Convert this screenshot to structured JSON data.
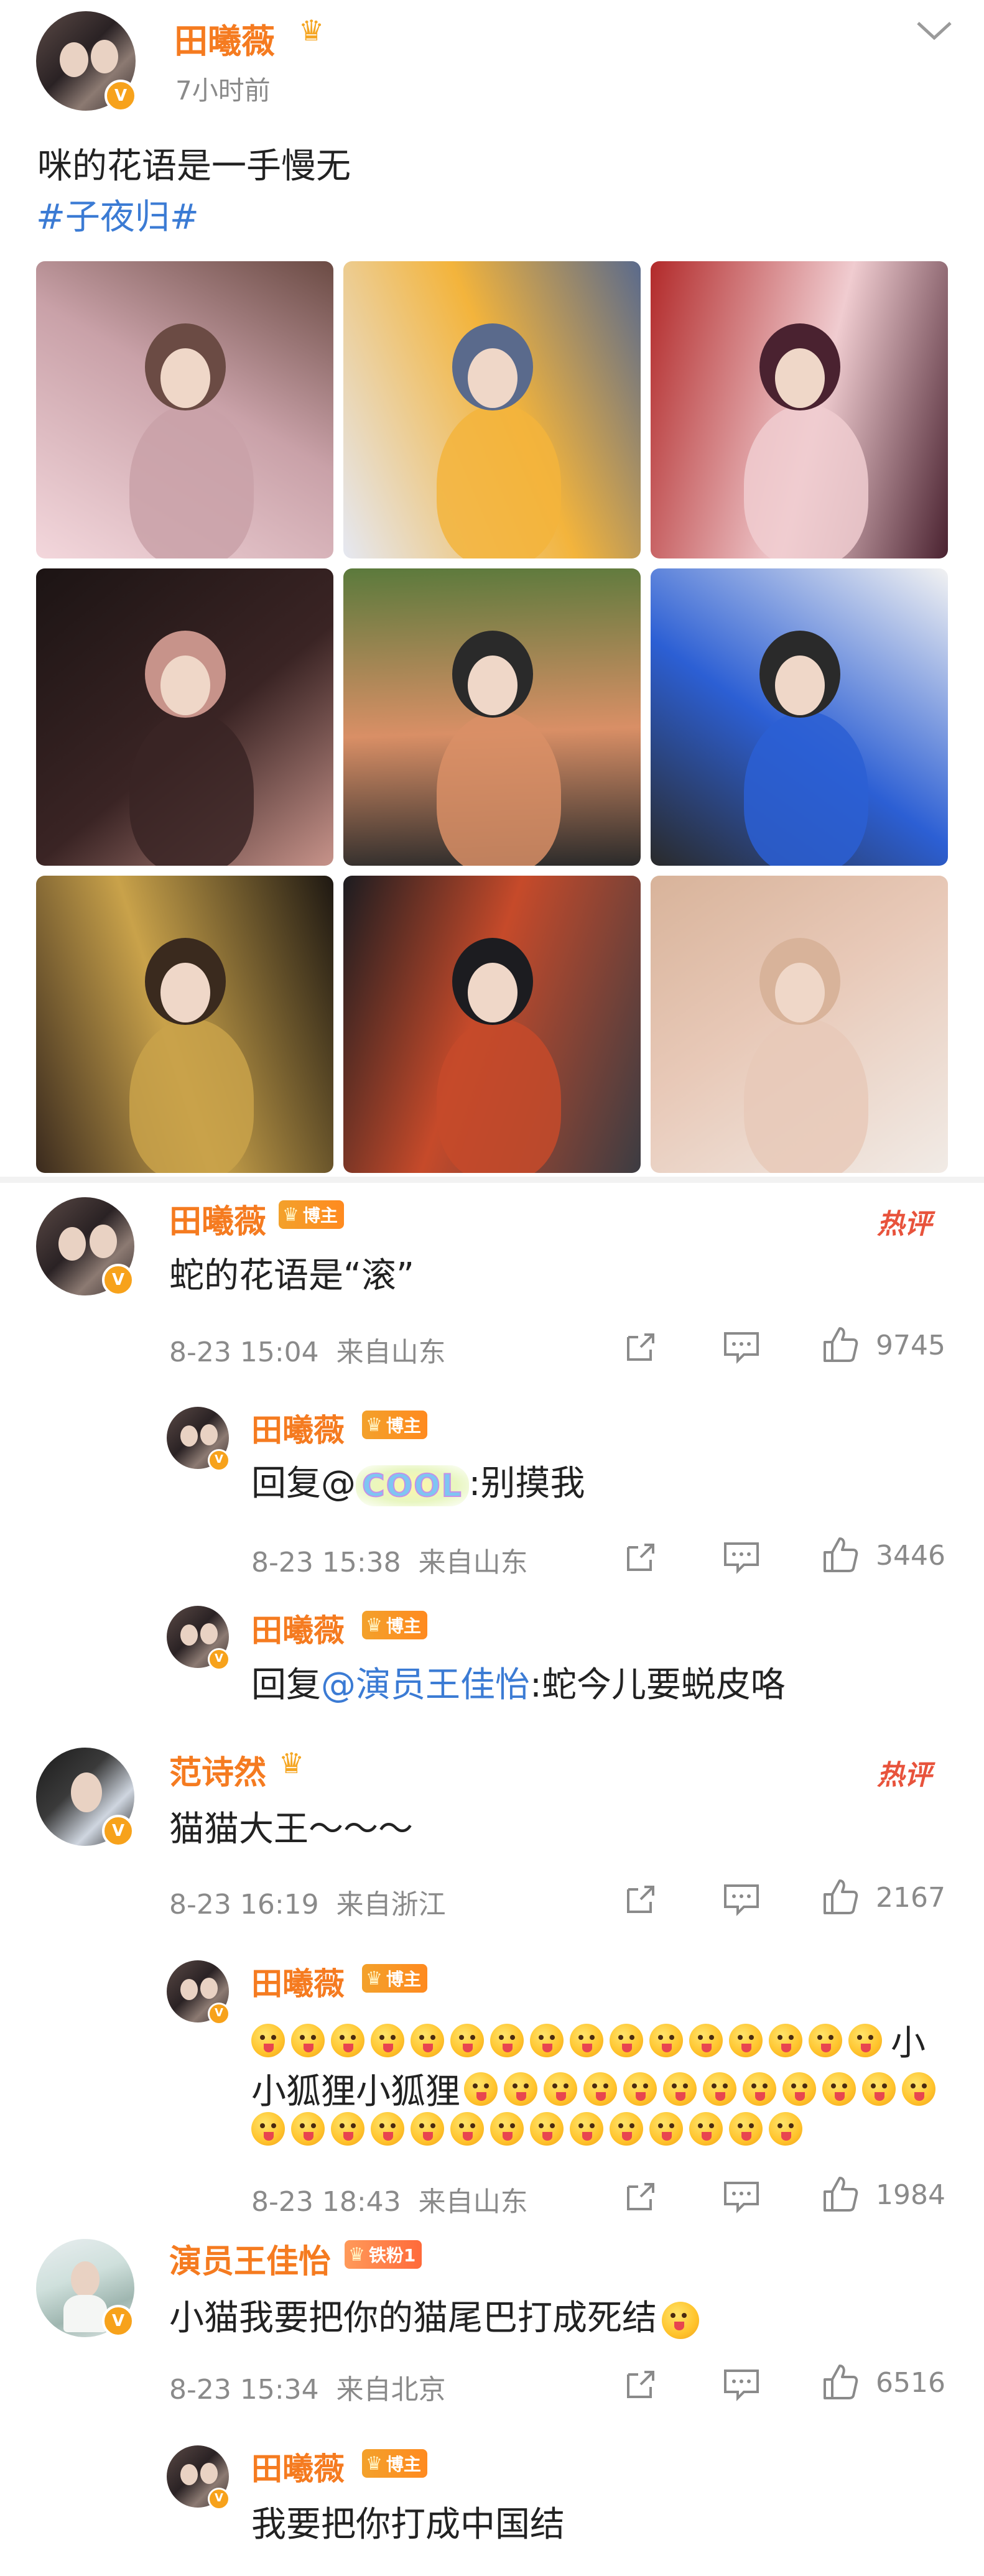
{
  "post": {
    "author": "田曦薇",
    "time": "7小时前",
    "text": "咪的花语是一手慢无",
    "topic": "#子夜归#",
    "more_icon": "chevron-down-icon",
    "verified_mark": "V",
    "photos": [
      {
        "palette": [
          "#f3d7dc",
          "#c9a1a8",
          "#6b4b44"
        ]
      },
      {
        "palette": [
          "#e5e8f2",
          "#f3b43c",
          "#5a6a8c"
        ]
      },
      {
        "palette": [
          "#b22a2a",
          "#f0ccd0",
          "#4a2230"
        ]
      },
      {
        "palette": [
          "#1c1414",
          "#3a2424",
          "#c7938a"
        ]
      },
      {
        "palette": [
          "#5b7a3c",
          "#d98f66",
          "#2a2a2a"
        ]
      },
      {
        "palette": [
          "#f2f2f2",
          "#2c5fd4",
          "#2a2a2a"
        ]
      },
      {
        "palette": [
          "#1e1812",
          "#c9a24a",
          "#3a2a1e"
        ]
      },
      {
        "palette": [
          "#3c3c42",
          "#c64a2a",
          "#1c1c20"
        ]
      },
      {
        "palette": [
          "#f1ebe6",
          "#e8c9b8",
          "#d8b39a"
        ]
      }
    ]
  },
  "host_label": "博主",
  "hot_label": "热评",
  "comments": [
    {
      "author": "田曦薇",
      "badge": "博主",
      "text": "蛇的花语是“滚”",
      "hot": true,
      "date": "8-23 15:04",
      "location": "来自山东",
      "likes": "9745",
      "replies": [
        {
          "author": "田曦薇",
          "badge": "博主",
          "prefix": "回复@",
          "mention": "COOL",
          "suffix": ":别摸我",
          "date": "8-23 15:38",
          "location": "来自山东",
          "likes": "3446"
        },
        {
          "author": "田曦薇",
          "badge": "博主",
          "prefix": "回复",
          "mention": "@演员王佳怡",
          "suffix": ":蛇今儿要蜕皮咯"
        }
      ]
    },
    {
      "author": "范诗然",
      "text": "猫猫大王～～～",
      "hot": true,
      "date": "8-23 16:19",
      "location": "来自浙江",
      "likes": "2167",
      "replies": [
        {
          "author": "田曦薇",
          "badge": "博主",
          "text_mid": "小狐狸小狐狸",
          "text_end": "小",
          "date": "8-23 18:43",
          "location": "来自山东",
          "likes": "1984"
        }
      ]
    },
    {
      "author": "演员王佳怡",
      "badge": "铁粉1",
      "text": "小猫我要把你的猫尾巴打成死结",
      "date": "8-23 15:34",
      "location": "来自北京",
      "likes": "6516",
      "replies": [
        {
          "author": "田曦薇",
          "badge": "博主",
          "text": "我要把你打成中国结"
        }
      ]
    }
  ],
  "icons": {
    "share": "share-icon",
    "comment": "comment-icon",
    "like": "like-icon",
    "crown": "crown-icon"
  }
}
